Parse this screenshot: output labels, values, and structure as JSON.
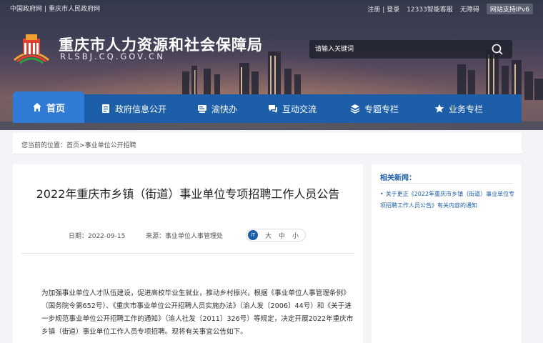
{
  "top_links": {
    "gov_cn": "中国政府网",
    "cq_gov": "重庆市人民政府网",
    "register": "注册",
    "login": "登录",
    "hotline": "12333智能客服",
    "accessibility": "无障碍",
    "ipv6": "网站支持IPv6"
  },
  "site": {
    "title": "重庆市人力资源和社会保障局",
    "domain": "RLSBJ.CQ.GOV.CN"
  },
  "search": {
    "placeholder": "请输入关键词"
  },
  "nav": {
    "items": [
      {
        "label": "首页",
        "icon": "home-icon"
      },
      {
        "label": "政府信息公开",
        "icon": "document-icon"
      },
      {
        "label": "渝快办",
        "icon": "service-icon"
      },
      {
        "label": "互动交流",
        "icon": "chat-icon"
      },
      {
        "label": "专题专栏",
        "icon": "layers-icon"
      },
      {
        "label": "业务专栏",
        "icon": "star-icon"
      }
    ]
  },
  "breadcrumb": {
    "prefix": "您当前的位置：",
    "home": "首页",
    "separator": ">",
    "current": "事业单位公开招聘"
  },
  "article": {
    "title": "2022年重庆市乡镇（街道）事业单位专项招聘工作人员公告",
    "date": "日期：2022-09-15",
    "source": "来源：事业单位人事管理处",
    "font_icon": "iT",
    "font_large": "大",
    "font_medium": "中",
    "font_small": "小",
    "body": "为加强事业单位人才队伍建设，促进高校毕业生就业，推动乡村振兴，根据《事业单位人事管理条例》（国务院令第652号）、《重庆市事业单位公开招聘人员实施办法》（渝人发〔2006〕44号）和《关于进一步规范事业单位公开招聘工作的通知》（渝人社发〔2011〕326号）等规定，决定开展2022年重庆市乡镇（街道）事业单位工作人员专项招聘。现将有关事宜公告如下。"
  },
  "sidebar": {
    "heading": "相关新闻：",
    "items": [
      {
        "label": "关于更正《2022年重庆市乡镇（街道）事业单位专项招聘工作人员公告》有关内容的通知"
      }
    ]
  },
  "colors": {
    "nav_bg": "#1c5ea8",
    "nav_active": "#2f7bd6",
    "link": "#1c5ea8"
  }
}
